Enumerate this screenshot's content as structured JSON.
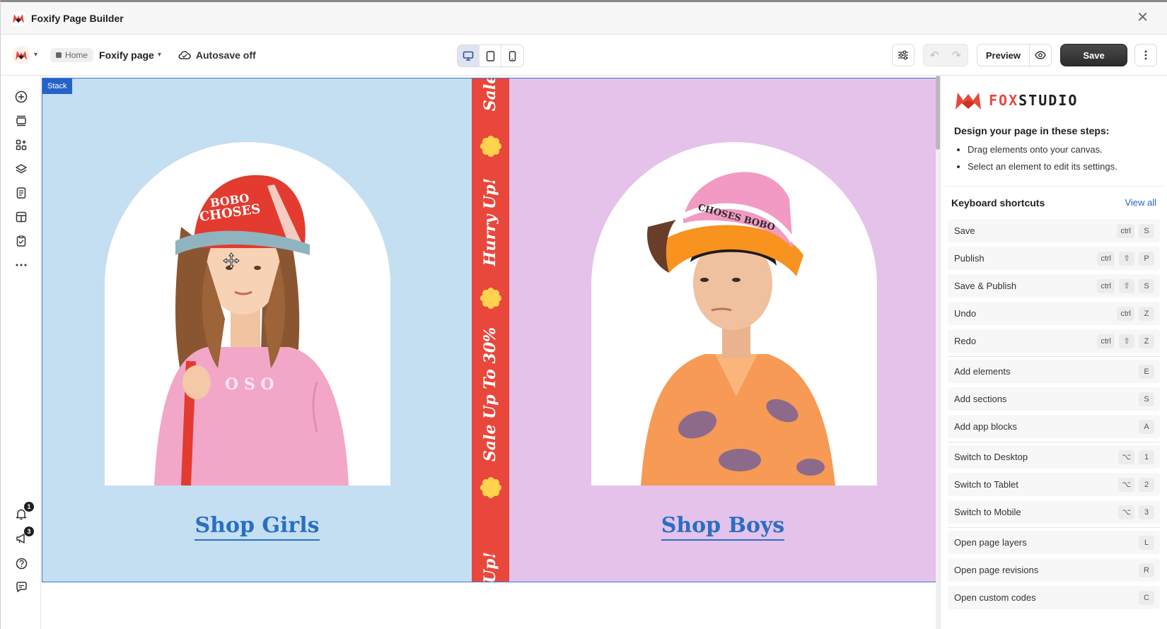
{
  "window": {
    "title": "Foxify Page Builder"
  },
  "toolbar": {
    "breadcrumb_home": "Home",
    "page_name": "Foxify page",
    "autosave": "Autosave off",
    "preview_label": "Preview",
    "save_label": "Save",
    "devices": [
      "desktop",
      "tablet",
      "mobile"
    ],
    "active_device": "desktop"
  },
  "sidebar": {
    "icons": [
      "add-icon",
      "sections-icon",
      "app-blocks-icon",
      "layers-icon",
      "pages-icon",
      "layout-icon",
      "checklist-icon",
      "more-icon"
    ],
    "bottom_icons": [
      "bell-icon",
      "megaphone-icon",
      "help-icon",
      "chat-icon"
    ],
    "notifications_count": "1",
    "announcements_count": "3"
  },
  "canvas": {
    "stack_label": "Stack",
    "girls_cta": "Shop Girls",
    "boys_cta": "Shop Boys",
    "marquee": {
      "t1": "Sale",
      "t2": "Hurry Up!",
      "t3": "Sale Up To 30%",
      "t4": "Up!"
    },
    "colors": {
      "girls_bg": "#c4def2",
      "boys_bg": "#e4c2ea",
      "marquee_bg": "#e9473c",
      "flower": "#ffd34d",
      "cta": "#2a6fc1"
    }
  },
  "panel": {
    "brand_fox": "FOX",
    "brand_studio": "STUDIO",
    "intro_title": "Design your page in these steps:",
    "steps": [
      "Drag elements onto your canvas.",
      "Select an element to edit its settings."
    ],
    "shortcuts_title": "Keyboard shortcuts",
    "view_all": "View all",
    "shortcuts": [
      {
        "label": "Save",
        "keys": [
          "ctrl",
          "S"
        ]
      },
      {
        "label": "Publish",
        "keys": [
          "ctrl",
          "⇧",
          "P"
        ]
      },
      {
        "label": "Save & Publish",
        "keys": [
          "ctrl",
          "⇧",
          "S"
        ]
      },
      {
        "label": "Undo",
        "keys": [
          "ctrl",
          "Z"
        ]
      },
      {
        "label": "Redo",
        "keys": [
          "ctrl",
          "⇧",
          "Z"
        ]
      },
      {
        "label": "Add elements",
        "keys": [
          "E"
        ]
      },
      {
        "label": "Add sections",
        "keys": [
          "S"
        ]
      },
      {
        "label": "Add app blocks",
        "keys": [
          "A"
        ]
      },
      {
        "label": "Switch to Desktop",
        "keys": [
          "⌥",
          "1"
        ]
      },
      {
        "label": "Switch to Tablet",
        "keys": [
          "⌥",
          "2"
        ]
      },
      {
        "label": "Switch to Mobile",
        "keys": [
          "⌥",
          "3"
        ]
      },
      {
        "label": "Open page layers",
        "keys": [
          "L"
        ]
      },
      {
        "label": "Open page revisions",
        "keys": [
          "R"
        ]
      },
      {
        "label": "Open custom codes",
        "keys": [
          "C"
        ]
      }
    ]
  }
}
